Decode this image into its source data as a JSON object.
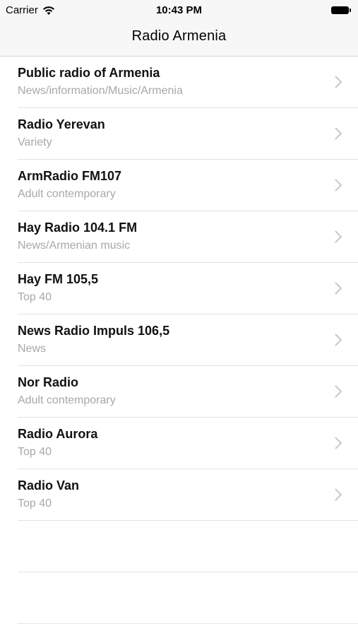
{
  "status_bar": {
    "carrier": "Carrier",
    "time": "10:43 PM"
  },
  "nav": {
    "title": "Radio Armenia"
  },
  "stations": [
    {
      "name": "Public radio of Armenia",
      "genre": "News/information/Music/Armenia"
    },
    {
      "name": "Radio Yerevan",
      "genre": "Variety"
    },
    {
      "name": "ArmRadio FM107",
      "genre": "Adult contemporary"
    },
    {
      "name": "Hay Radio 104.1 FM",
      "genre": "News/Armenian music"
    },
    {
      "name": "Hay FM 105,5",
      "genre": "Top 40"
    },
    {
      "name": "News Radio Impuls 106,5",
      "genre": "News"
    },
    {
      "name": "Nor Radio",
      "genre": "Adult contemporary"
    },
    {
      "name": "Radio Aurora",
      "genre": "Top 40"
    },
    {
      "name": "Radio Van",
      "genre": "Top 40"
    }
  ],
  "icons": {
    "wifi": "wifi-icon",
    "battery": "battery-icon",
    "disclosure": "chevron-right-icon"
  }
}
